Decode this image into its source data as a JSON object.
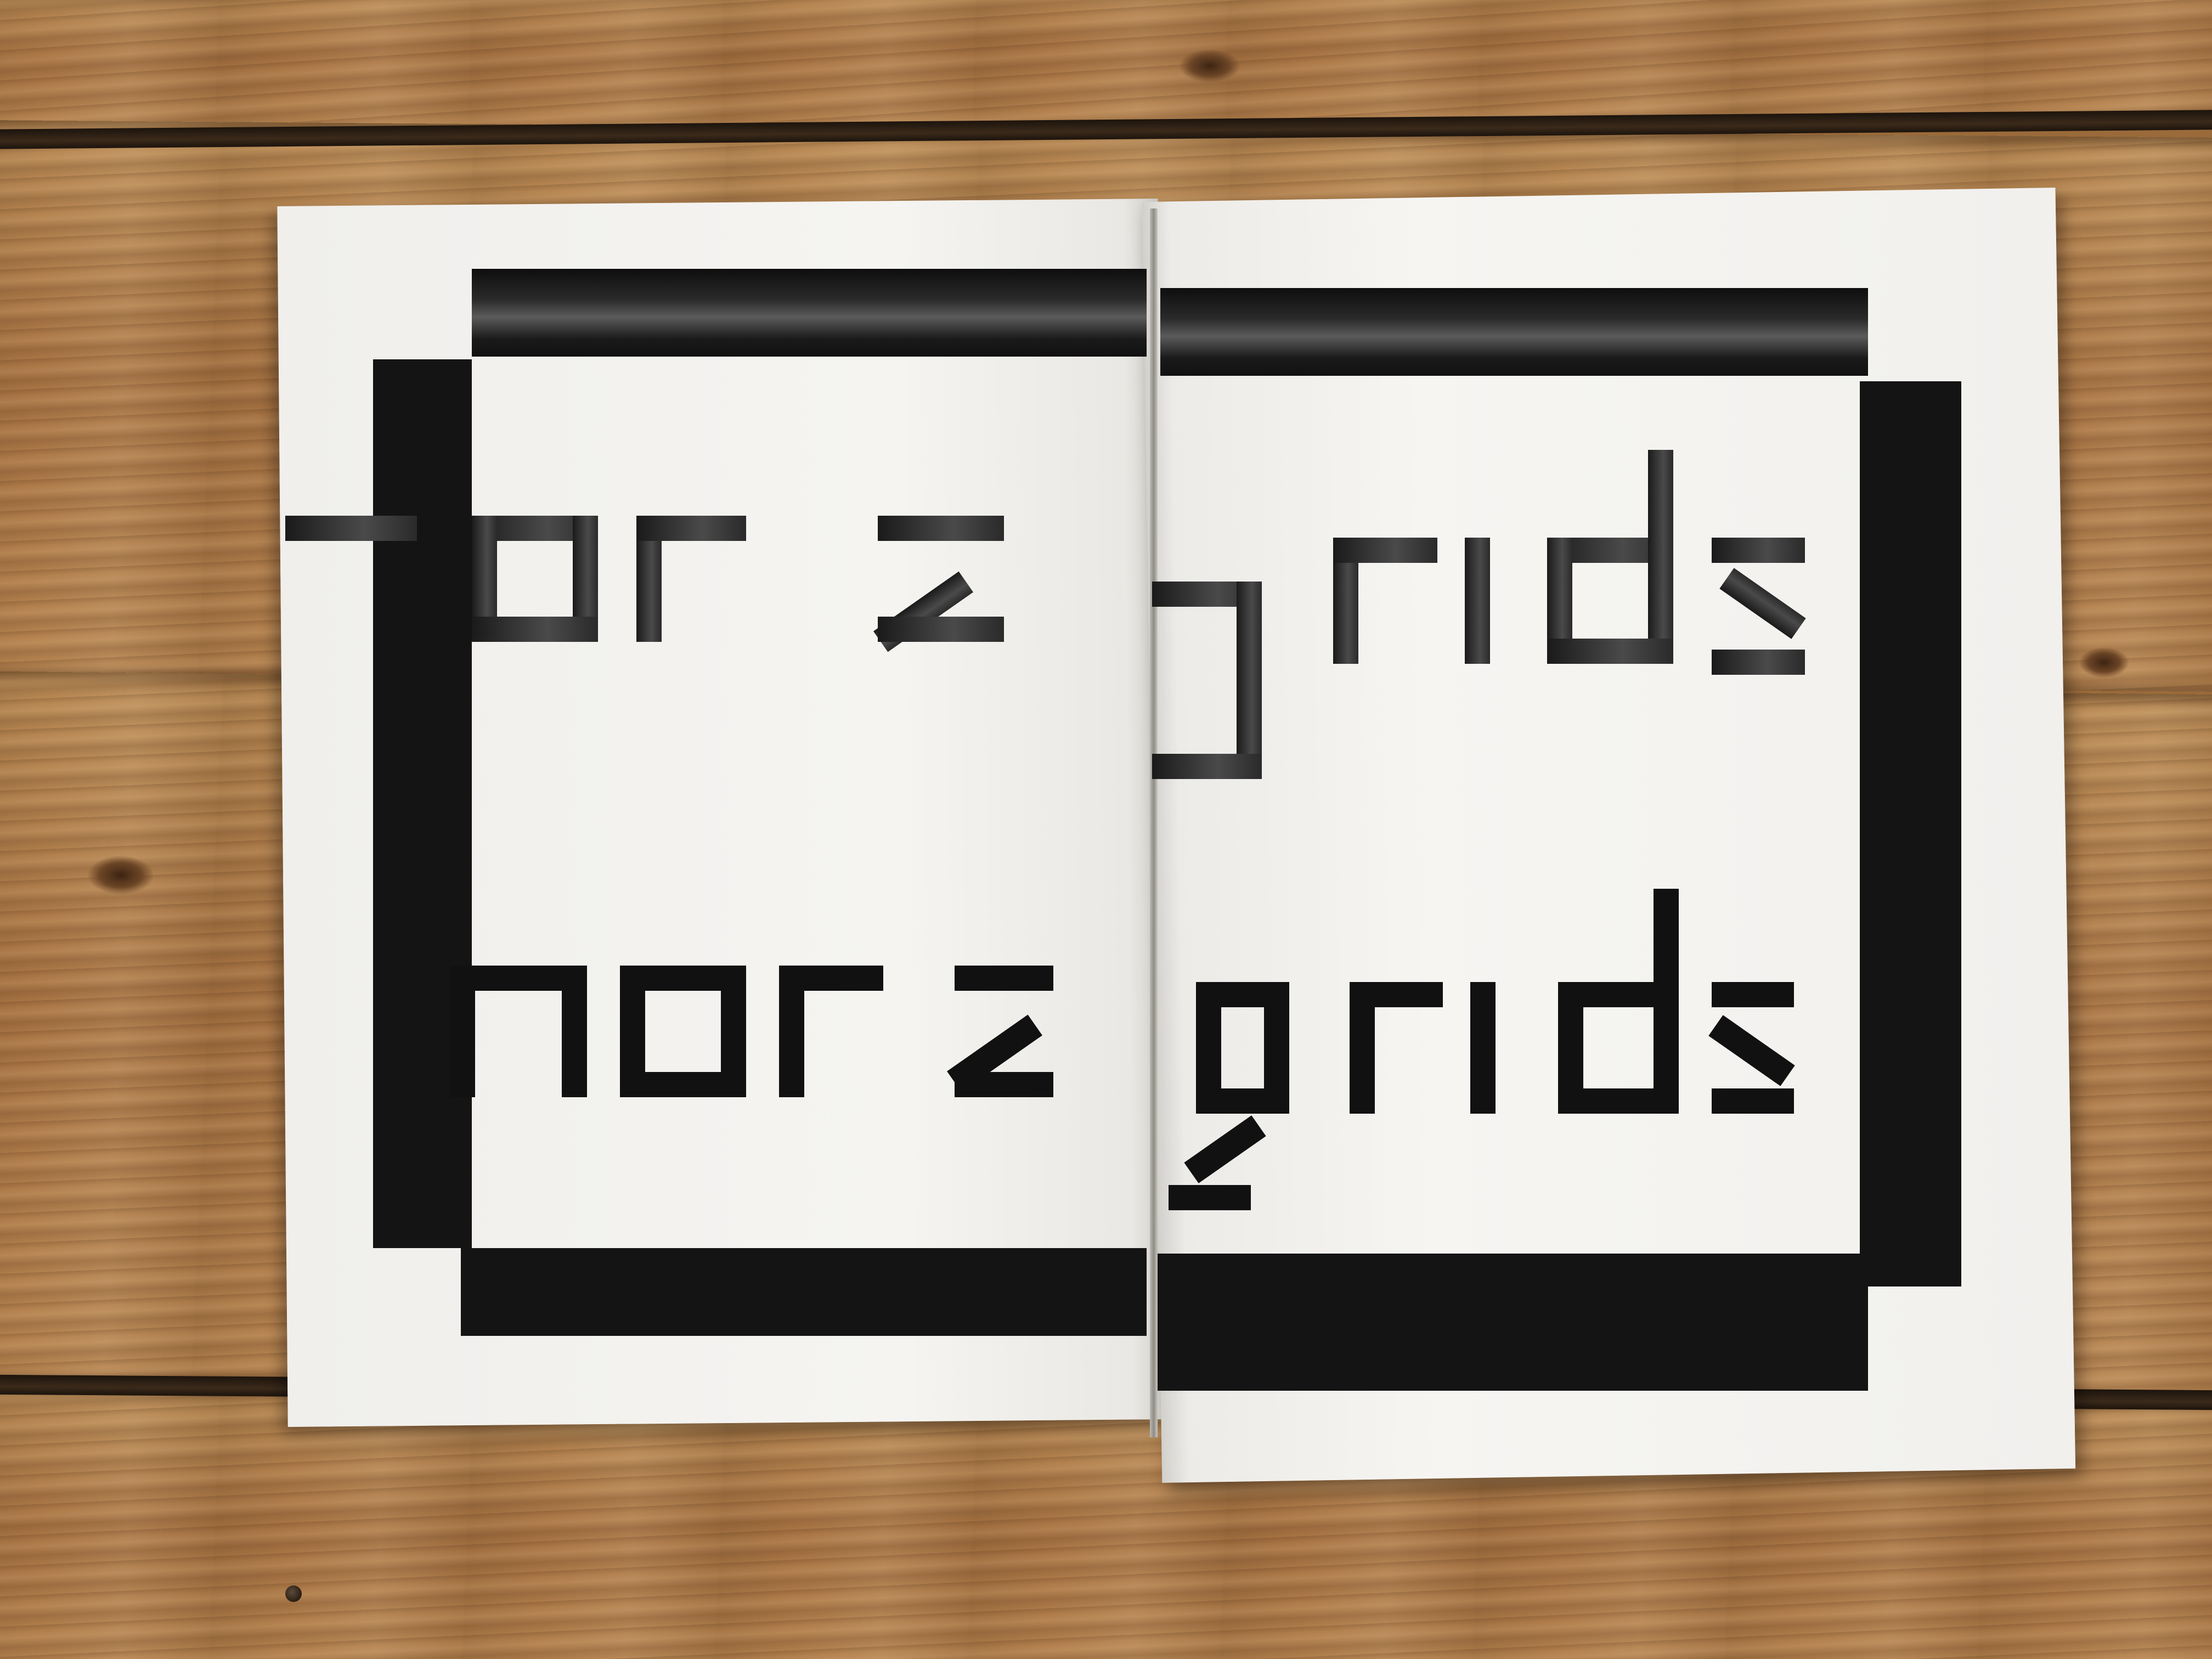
{
  "scene": {
    "subject": "open booklet on wooden floor",
    "colors": {
      "ink": "#141414",
      "paper": "#f2f1ee",
      "wood": "#a87444"
    }
  },
  "spread": {
    "line_1": {
      "word_1": "more",
      "word_2": "grids"
    },
    "line_2": {
      "word_1": "more",
      "word_2": "grids"
    }
  }
}
